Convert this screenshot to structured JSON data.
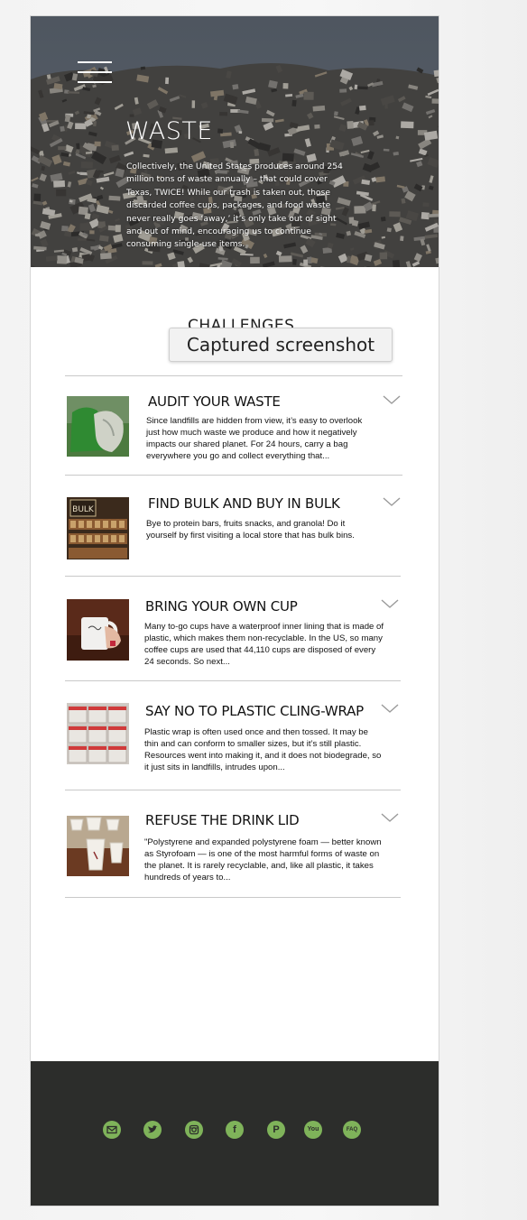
{
  "hero": {
    "title": "WASTE",
    "text": "Collectively, the United States produces around 254 million tons of waste annually – that could cover Texas, TWICE! While our trash is taken out, those discarded coffee cups, packages, and food waste never really goes ‘away,’ it’s only take out of sight and out of mind, encouraging us to continue consuming single-use items."
  },
  "section": {
    "title": "CHALLENGES",
    "tooltip": "Captured screenshot"
  },
  "items": [
    {
      "title": "AUDIT YOUR WASTE",
      "desc": "Since landfills are hidden from view, it’s easy to overlook just how much waste we produce and how it negatively impacts our shared planet. For 24 hours, carry a bag everywhere you go and collect everything that...",
      "image_icon": "green-bag-photo"
    },
    {
      "title": "FIND BULK AND BUY IN BULK",
      "desc": "Bye to protein bars, fruits snacks, and granola! Do it yourself by first visiting a local store that has bulk bins.",
      "image_icon": "bulk-store-photo",
      "image_text": "BULK"
    },
    {
      "title": "BRING YOUR OWN CUP",
      "desc": "Many to-go cups have a waterproof inner lining that is made of plastic, which makes them non-recyclable. In the US, so many coffee cups are used that 44,110 cups are disposed of every 24 seconds. So next...",
      "image_icon": "mug-photo"
    },
    {
      "title": "SAY NO TO PLASTIC CLING-WRAP",
      "desc": "Plastic wrap is often used once and then tossed. It may be thin and can conform to smaller sizes, but it’s still plastic. Resources went into making it, and it does not biodegrade, so it just sits in landfills, intrudes upon...",
      "image_icon": "containers-photo"
    },
    {
      "title": "REFUSE THE DRINK LID",
      "desc": "\"Polystyrene and expanded polystyrene foam — better known as Styrofoam — is one of the most harmful forms of waste on the planet. It is rarely recyclable, and, like all plastic, it takes hundreds of years to...",
      "image_icon": "paper-cups-photo"
    }
  ],
  "footer": {
    "social": [
      {
        "icon": "email-icon"
      },
      {
        "icon": "twitter-icon"
      },
      {
        "icon": "instagram-icon"
      },
      {
        "icon": "facebook-icon",
        "glyph": "f"
      },
      {
        "icon": "pinterest-icon",
        "glyph": "P"
      },
      {
        "icon": "youtube-icon",
        "glyph": "You"
      },
      {
        "icon": "faq-icon",
        "glyph": "FAQ"
      }
    ]
  },
  "colors": {
    "footer_bg": "#2c2d2b",
    "social_green": "#7fb35a",
    "divider": "#c9c9c9"
  }
}
